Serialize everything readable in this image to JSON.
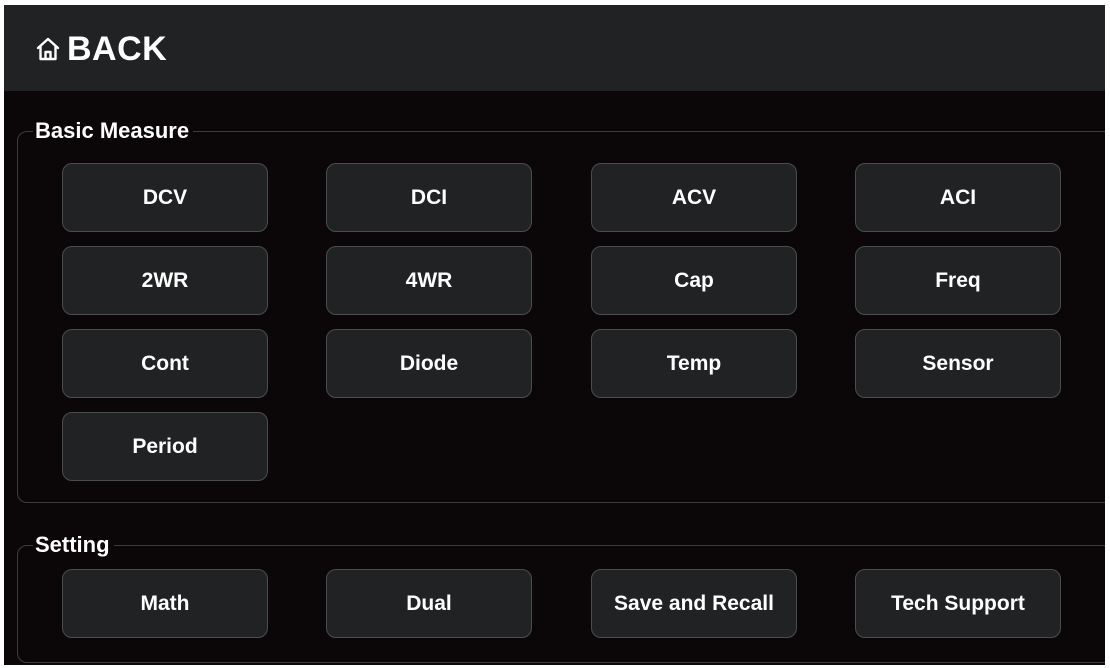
{
  "header": {
    "back_label": "BACK",
    "icon": "home-icon"
  },
  "basic_measure": {
    "title": "Basic Measure",
    "buttons": [
      {
        "label": "DCV"
      },
      {
        "label": "DCI"
      },
      {
        "label": "ACV"
      },
      {
        "label": "ACI"
      },
      {
        "label": "2WR"
      },
      {
        "label": "4WR"
      },
      {
        "label": "Cap"
      },
      {
        "label": "Freq"
      },
      {
        "label": "Cont"
      },
      {
        "label": "Diode"
      },
      {
        "label": "Temp"
      },
      {
        "label": "Sensor"
      },
      {
        "label": "Period"
      }
    ]
  },
  "setting": {
    "title": "Setting",
    "buttons": [
      {
        "label": "Math"
      },
      {
        "label": "Dual"
      },
      {
        "label": "Save and Recall"
      },
      {
        "label": "Tech Support"
      }
    ]
  },
  "colors": {
    "background": "#0b0708",
    "header_bg": "#202223",
    "button_bg": "#202223",
    "button_border": "#4a4c4e",
    "text": "#ffffff"
  }
}
